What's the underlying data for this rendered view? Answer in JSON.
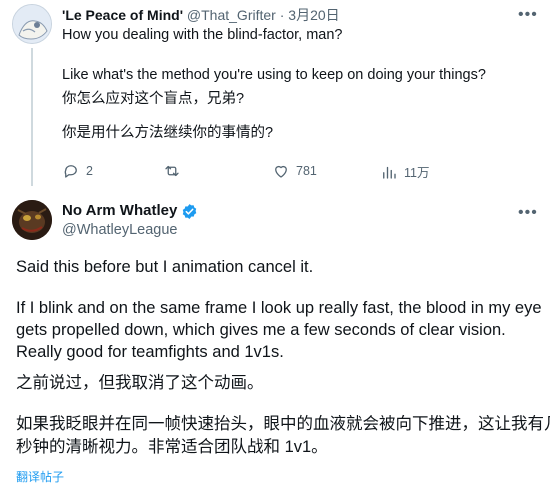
{
  "parent": {
    "display_name": "'Le Peace of Mind'",
    "handle": "@That_Grifter",
    "separator": "·",
    "date": "3月20日",
    "lines": [
      "How you dealing with the blind-factor, man?",
      "Like what's the method you're using to keep on doing your things?",
      "你怎么应对这个盲点，兄弟?",
      "你是用什么方法继续你的事情的?"
    ],
    "actions": {
      "reply_count": "2",
      "repost_count": "",
      "like_count": "781",
      "views_count": "11万"
    }
  },
  "main": {
    "display_name": "No Arm Whatley",
    "handle": "@WhatleyLeague",
    "lines": [
      "Said this before but I animation cancel it.",
      "If I blink and on the same frame I look up really fast, the blood in my eye",
      "gets propelled down, which gives me a few seconds of clear vision.",
      "Really good for teamfights and 1v1s.",
      "之前说过，但我取消了这个动画。",
      "如果我眨眼并在同一帧快速抬头，眼中的血液就会被向下推进，这让我有几",
      "秒钟的清晰视力。非常适合团队战和 1v1。"
    ],
    "translate_label": "翻译帖子"
  },
  "colors": {
    "text": "#0f1419",
    "secondary": "#536471",
    "accent": "#1d9bf0",
    "thread_line": "#cfd9de"
  },
  "icons": [
    "more-icon",
    "reply-icon",
    "repost-icon",
    "like-icon",
    "views-icon",
    "verified-badge-icon"
  ]
}
